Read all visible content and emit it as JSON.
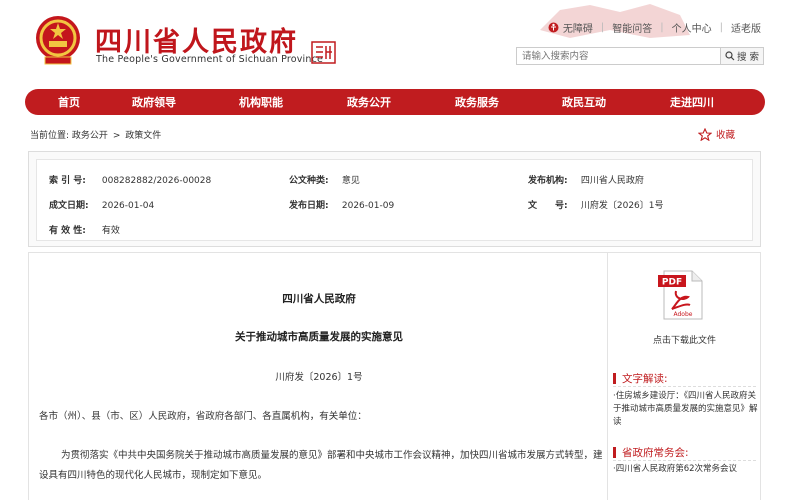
{
  "header": {
    "title": "四川省人民政府",
    "subtitle": "The People's Government of Sichuan Province",
    "toplinks": [
      "无障碍",
      "智能问答",
      "个人中心",
      "适老版"
    ]
  },
  "search": {
    "placeholder": "请输入搜索内容",
    "button_label": "搜 索"
  },
  "nav": {
    "items": [
      "首页",
      "政府领导",
      "机构职能",
      "政务公开",
      "政务服务",
      "政民互动",
      "走进四川"
    ]
  },
  "breadcrumb": {
    "prefix": "当前位置:",
    "items": [
      "政务公开",
      "政策文件"
    ],
    "separator": ">"
  },
  "favorite_label": "收藏",
  "meta": {
    "index_label": "索 引 号:",
    "index_value": "008282882/2026-00028",
    "doc_type_label": "公文种类:",
    "doc_type_value": "意见",
    "publisher_label": "发布机构:",
    "publisher_value": "四川省人民政府",
    "created_label": "成文日期:",
    "created_value": "2026-01-04",
    "published_label": "发布日期:",
    "published_value": "2026-01-09",
    "docno_label": "文　　号:",
    "docno_value": "川府发〔2026〕1号",
    "validity_label": "有 效 性:",
    "validity_value": "有效"
  },
  "document": {
    "issuer": "四川省人民政府",
    "title": "关于推动城市高质量发展的实施意见",
    "number": "川府发〔2026〕1号",
    "addressee": "各市（州）、县（市、区）人民政府，省政府各部门、各直属机构，有关单位：",
    "paragraph": "为贯彻落实《中共中央国务院关于推动城市高质量发展的意见》部署和中央城市工作会议精神，加快四川省城市发展方式转型，建设具有四川特色的现代化人民城市，现制定如下意见。"
  },
  "sidebar": {
    "pdf_label": "点击下载此文件",
    "interpretation_title": "文字解读:",
    "interpretation_text": "·住房城乡建设厅：《四川省人民政府关于推动城市高质量发展的实施意见》解读",
    "meeting_title": "省政府常务会:",
    "meeting_text": "·四川省人民政府第62次常务会议"
  },
  "colors": {
    "brand_red": "#c01c1f",
    "title_red": "#c0161c"
  }
}
